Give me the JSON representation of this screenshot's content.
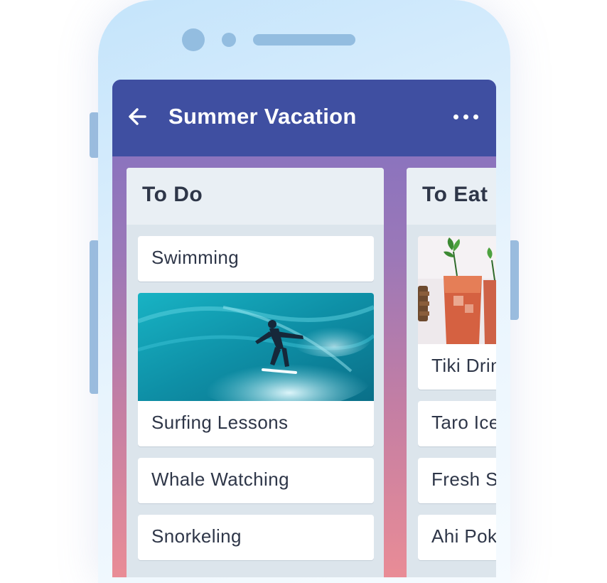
{
  "board": {
    "title": "Summer Vacation"
  },
  "lists": [
    {
      "title": "To Do",
      "cards": [
        {
          "label": "Swimming",
          "has_cover": false
        },
        {
          "label": "Surfing Lessons",
          "has_cover": true,
          "cover": "surfer-photo"
        },
        {
          "label": "Whale Watching",
          "has_cover": false
        },
        {
          "label": "Snorkeling",
          "has_cover": false
        }
      ]
    },
    {
      "title": "To Eat",
      "cards": [
        {
          "label": "Tiki Drinks",
          "has_cover": true,
          "cover": "drinks-photo"
        },
        {
          "label": "Taro Ice Cream",
          "has_cover": false
        },
        {
          "label": "Fresh Sushi",
          "has_cover": false
        },
        {
          "label": "Ahi Poke",
          "has_cover": false
        }
      ]
    }
  ],
  "icons": {
    "back": "arrow-left-icon",
    "more": "more-horizontal-icon"
  },
  "colors": {
    "header": "#3f4fa1",
    "list_bg": "#dce5ec",
    "card_text": "#2e3648",
    "phone_frame": "#c4e4fb"
  }
}
